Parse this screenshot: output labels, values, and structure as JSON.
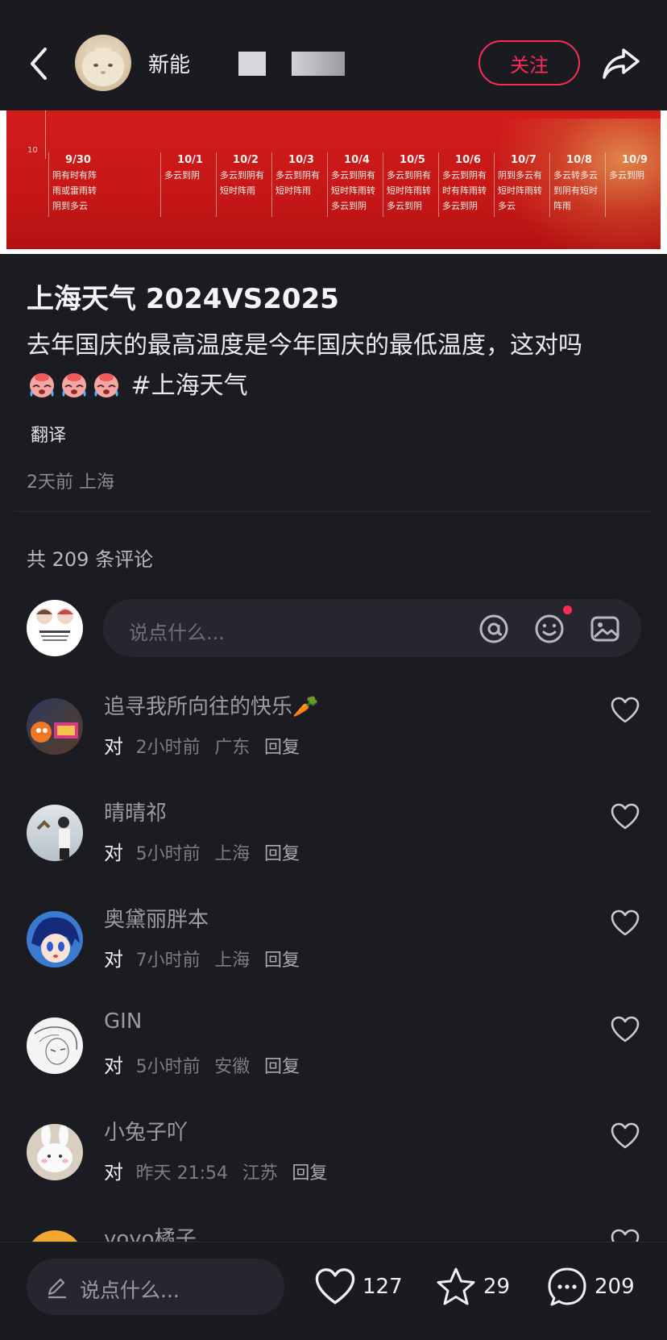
{
  "header": {
    "author_name": "新能",
    "follow_label": "关注"
  },
  "banner": {
    "tick_label": "10",
    "columns": [
      {
        "date": "9/30",
        "lines": [
          "阴有时有阵",
          "雨或雷雨转",
          "阴到多云"
        ]
      },
      {
        "date": "10/1",
        "lines": [
          "多云到阴",
          "",
          ""
        ]
      },
      {
        "date": "10/2",
        "lines": [
          "多云到阴有",
          "短时阵雨",
          ""
        ]
      },
      {
        "date": "10/3",
        "lines": [
          "多云到阴有",
          "短时阵雨",
          ""
        ]
      },
      {
        "date": "10/4",
        "lines": [
          "多云到阴有",
          "短时阵雨转",
          "多云到阴"
        ]
      },
      {
        "date": "10/5",
        "lines": [
          "多云到阴有",
          "短时阵雨转",
          "多云到阴"
        ]
      },
      {
        "date": "10/6",
        "lines": [
          "多云到阴有",
          "时有阵雨转",
          "多云到阴"
        ]
      },
      {
        "date": "10/7",
        "lines": [
          "阴到多云有",
          "短时阵雨转",
          "多云"
        ]
      },
      {
        "date": "10/8",
        "lines": [
          "多云转多云",
          "到阴有短时",
          "阵雨"
        ]
      },
      {
        "date": "10/9",
        "lines": [
          "多云到阴",
          "",
          ""
        ]
      }
    ]
  },
  "post": {
    "title": "上海天气 2024VS2025",
    "body": "去年国庆的最高温度是今年国庆的最低温度，这对吗",
    "hashtag": "#上海天气",
    "translate_label": "翻译",
    "time_ago": "2天前",
    "location": "上海"
  },
  "comments_section": {
    "count_label": "共 209 条评论",
    "input_placeholder": "说点什么...",
    "items": [
      {
        "name": "追寻我所向往的快乐🥕",
        "text": "对",
        "time": "2小时前",
        "location": "广东",
        "reply": "回复"
      },
      {
        "name": "晴晴祁",
        "text": "对",
        "time": "5小时前",
        "location": "上海",
        "reply": "回复"
      },
      {
        "name": "奥黛丽胖本",
        "text": "对",
        "time": "7小时前",
        "location": "上海",
        "reply": "回复"
      },
      {
        "name": "GIN",
        "text": "对",
        "time": "5小时前",
        "location": "安徽",
        "reply": "回复"
      },
      {
        "name": "小兔子吖",
        "text": "对",
        "time": "昨天 21:54",
        "location": "江苏",
        "reply": "回复"
      },
      {
        "name": "yoyo橘子",
        "text": "",
        "time": "",
        "location": "",
        "reply": ""
      }
    ]
  },
  "bottom_bar": {
    "input_placeholder": "说点什么...",
    "likes": "127",
    "favorites": "29",
    "comments": "209"
  },
  "colors": {
    "accent": "#fe2c55",
    "background": "#1b1b22",
    "banner_red": "#c61717"
  }
}
